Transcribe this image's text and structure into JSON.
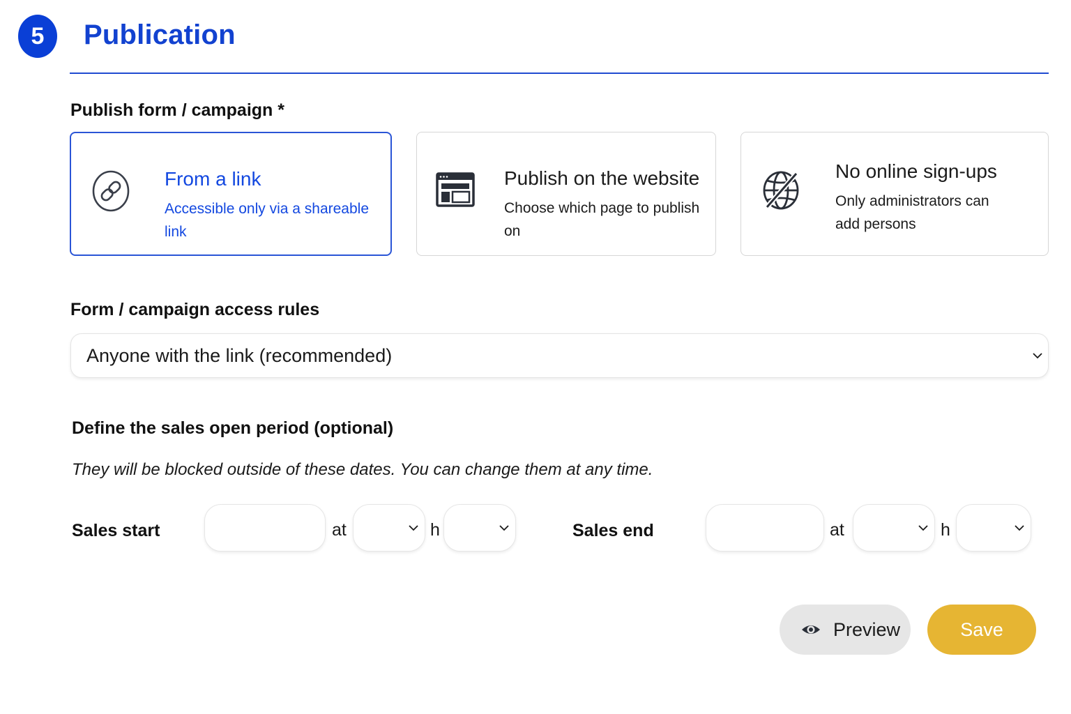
{
  "section": {
    "step_number": "5",
    "title": "Publication"
  },
  "publish": {
    "label": "Publish form / campaign *",
    "options": [
      {
        "title": "From a link",
        "description": "Accessible only via a shareable link",
        "icon": "link-icon",
        "selected": true
      },
      {
        "title": "Publish on the website",
        "description": "Choose which page to publish on",
        "icon": "browser-window-icon",
        "selected": false
      },
      {
        "title": "No online sign-ups",
        "description_line1": "Only administrators can",
        "description_line2": "add persons",
        "icon": "globe-off-icon",
        "selected": false
      }
    ]
  },
  "access": {
    "label": "Form / campaign access rules",
    "selected_value": "Anyone with the link (recommended)"
  },
  "sales_period": {
    "label": "Define the sales open period (optional)",
    "help_text": "They will be blocked outside of these dates. You can change them at any time.",
    "start": {
      "label": "Sales start",
      "date_value": "",
      "at_text": "at",
      "hour_value": "",
      "h_text": "h",
      "minute_value": ""
    },
    "end": {
      "label": "Sales end",
      "date_value": "",
      "at_text": "at",
      "hour_value": "",
      "h_text": "h",
      "minute_value": ""
    }
  },
  "actions": {
    "preview_label": "Preview",
    "save_label": "Save"
  },
  "colors": {
    "accent_blue": "#0a3fd6",
    "save_yellow": "#e6b533",
    "preview_gray": "#e6e6e6"
  }
}
